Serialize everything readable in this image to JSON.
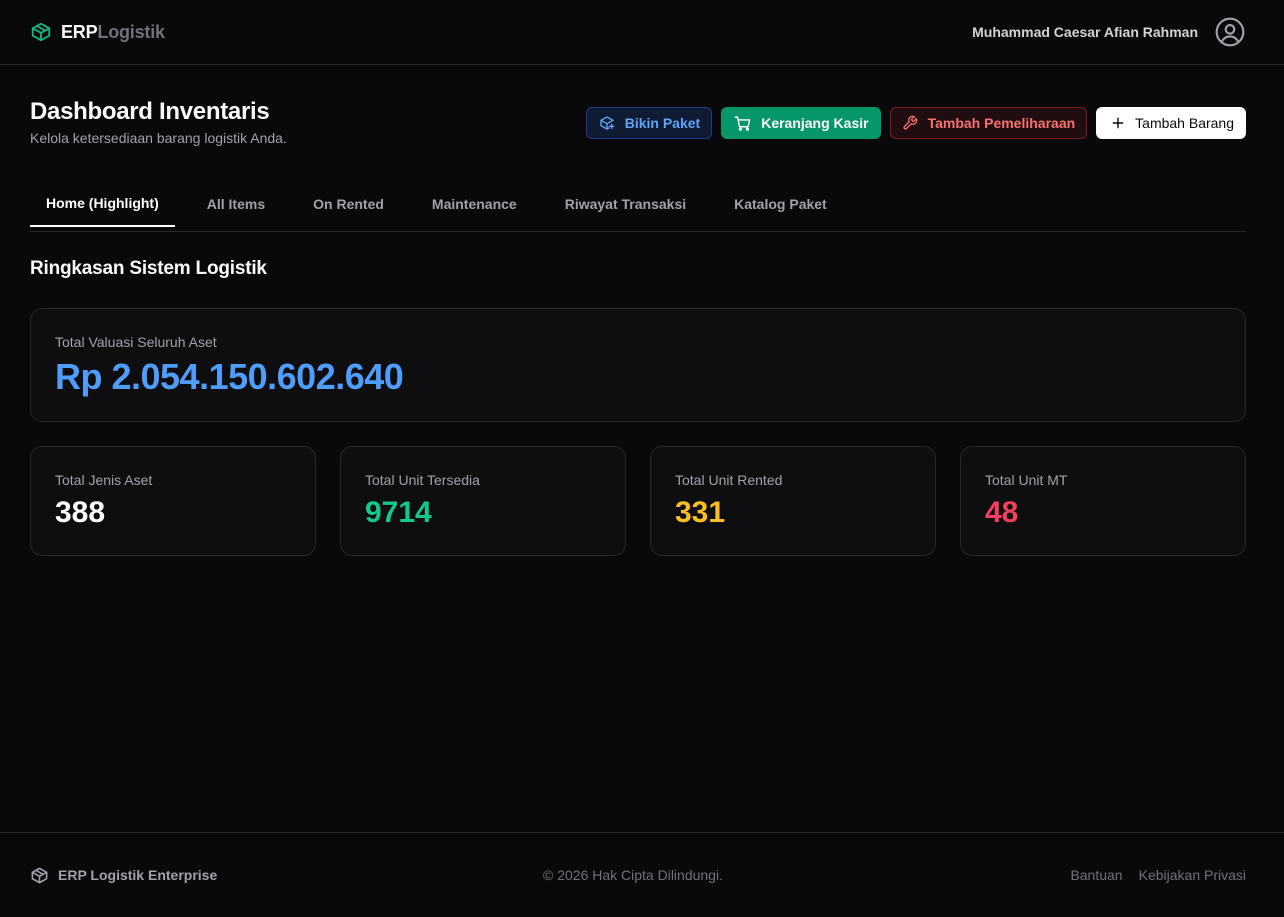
{
  "header": {
    "brand_primary": "ERP",
    "brand_secondary": "Logistik",
    "user_name": "Muhammad Caesar Afian Rahman"
  },
  "page": {
    "title": "Dashboard Inventaris",
    "subtitle": "Kelola ketersediaan barang logistik Anda."
  },
  "actions": {
    "bikin_paket": "Bikin Paket",
    "keranjang_kasir": "Keranjang Kasir",
    "tambah_pemeliharaan": "Tambah Pemeliharaan",
    "tambah_barang": "Tambah Barang"
  },
  "tabs": [
    {
      "label": "Home (Highlight)",
      "active": true
    },
    {
      "label": "All Items",
      "active": false
    },
    {
      "label": "On Rented",
      "active": false
    },
    {
      "label": "Maintenance",
      "active": false
    },
    {
      "label": "Riwayat Transaksi",
      "active": false
    },
    {
      "label": "Katalog Paket",
      "active": false
    }
  ],
  "summary": {
    "title": "Ringkasan Sistem Logistik",
    "valuation_label": "Total Valuasi Seluruh Aset",
    "valuation_value": "Rp 2.054.150.602.640",
    "stats": [
      {
        "label": "Total Jenis Aset",
        "value": "388",
        "color": "#ffffff"
      },
      {
        "label": "Total Unit Tersedia",
        "value": "9714",
        "color": "#10c98b"
      },
      {
        "label": "Total Unit Rented",
        "value": "331",
        "color": "#fbbf24"
      },
      {
        "label": "Total Unit MT",
        "value": "48",
        "color": "#f43f5e"
      }
    ]
  },
  "footer": {
    "brand": "ERP Logistik Enterprise",
    "copyright": "© 2026 Hak Cipta Dilindungi.",
    "links": [
      "Bantuan",
      "Kebijakan Privasi"
    ]
  },
  "colors": {
    "accent_blue": "#4f9cf9",
    "accent_green": "#10b981",
    "background": "#09090b"
  },
  "icons": {
    "brand": "package-icon",
    "user": "user-circle-icon",
    "bikin_paket": "package-plus-icon",
    "keranjang_kasir": "shopping-cart-icon",
    "tambah_pemeliharaan": "wrench-icon",
    "tambah_barang": "plus-icon"
  }
}
